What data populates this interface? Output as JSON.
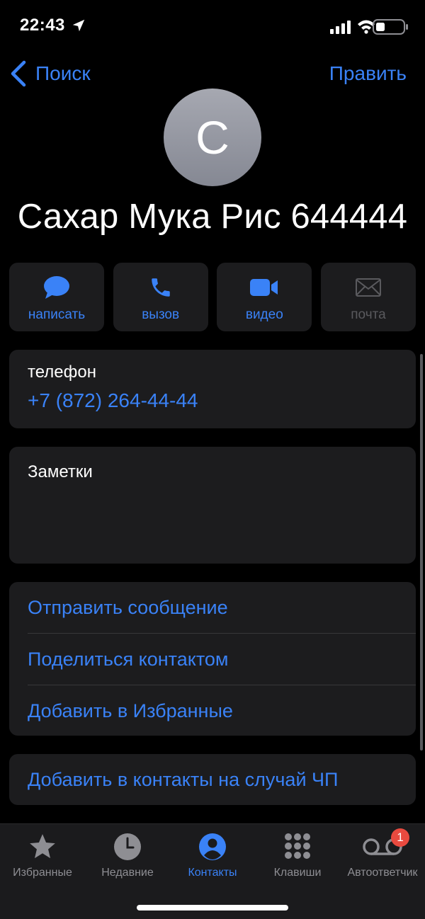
{
  "status": {
    "time": "22:43",
    "icons": [
      "location-arrow-icon",
      "cellular-signal-icon",
      "wifi-icon",
      "battery-icon"
    ]
  },
  "nav": {
    "back_label": "Поиск",
    "edit_label": "Править"
  },
  "contact": {
    "initial": "С",
    "name": "Сахар Мука Рис 644444"
  },
  "actions": [
    {
      "label": "написать",
      "icon": "message-bubble-icon",
      "enabled": true
    },
    {
      "label": "вызов",
      "icon": "phone-icon",
      "enabled": true
    },
    {
      "label": "видео",
      "icon": "video-camera-icon",
      "enabled": true
    },
    {
      "label": "почта",
      "icon": "envelope-icon",
      "enabled": false
    }
  ],
  "phone": {
    "label": "телефон",
    "number": "+7 (872) 264-44-44"
  },
  "notes": {
    "label": "Заметки",
    "value": ""
  },
  "links": [
    "Отправить сообщение",
    "Поделиться контактом",
    "Добавить в Избранные"
  ],
  "emergency": "Добавить в контакты на случай ЧП",
  "tabbar": {
    "tabs": [
      {
        "label": "Избранные",
        "icon": "star-icon",
        "active": false
      },
      {
        "label": "Недавние",
        "icon": "clock-icon",
        "active": false
      },
      {
        "label": "Контакты",
        "icon": "person-circle-icon",
        "active": true
      },
      {
        "label": "Клавиши",
        "icon": "keypad-icon",
        "active": false
      },
      {
        "label": "Автоответчик",
        "icon": "voicemail-icon",
        "active": false,
        "badge": "1"
      }
    ]
  },
  "colors": {
    "accent": "#3a82f7",
    "background": "#000000",
    "card": "#1c1c1e",
    "badge": "#e94a3f",
    "inactive": "#8e8e93"
  }
}
